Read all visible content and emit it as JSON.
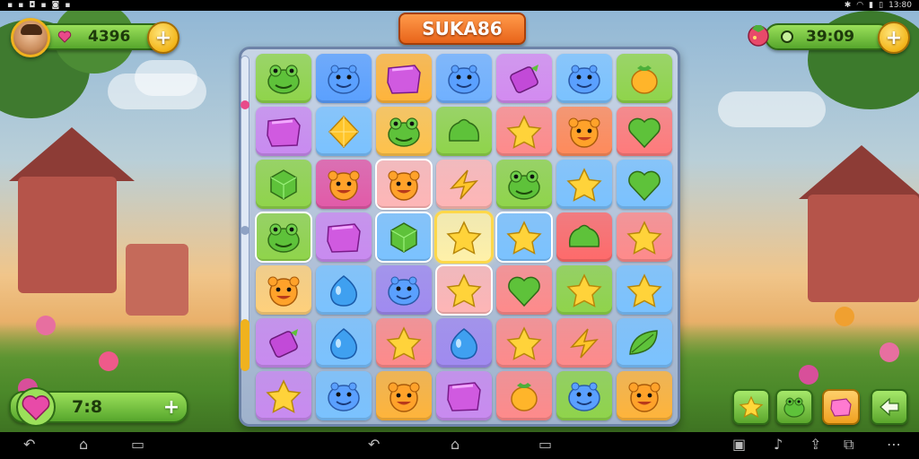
{
  "status_bar": {
    "left_icons": [
      "notification-icon",
      "notification-icon",
      "notification-icon",
      "notification-icon",
      "notification-icon",
      "notification-icon"
    ],
    "right_icons": [
      "bluetooth-icon",
      "wifi-icon",
      "signal-icon",
      "battery-icon"
    ],
    "time": "13:80"
  },
  "hud": {
    "score": "4396",
    "timer": "39:09",
    "lives": "7:8",
    "plus_label": "+"
  },
  "title": "SUKA86",
  "board": {
    "rows": [
      [
        "frog",
        "hippo",
        "cube",
        "hippo",
        "candy",
        "hippo",
        "fruit"
      ],
      [
        "cube",
        "diamond",
        "frog",
        "blob",
        "star",
        "bear",
        "heart"
      ],
      [
        "gem",
        "bear",
        "bear",
        "bolt",
        "frog",
        "star",
        "heart"
      ],
      [
        "frog",
        "cube",
        "gem",
        "star",
        "star",
        "blob",
        "star"
      ],
      [
        "bear",
        "drop",
        "hippo",
        "star",
        "heart",
        "star",
        "star"
      ],
      [
        "candy",
        "drop",
        "star",
        "drop",
        "star",
        "bolt",
        "leaf"
      ],
      [
        "star",
        "hippo",
        "bear",
        "cube",
        "fruit",
        "hippo",
        "bear"
      ]
    ],
    "colors": [
      [
        "#8fd44a",
        "#5aa0ff",
        "#ffb43a",
        "#6fb0ff",
        "#d38af0",
        "#7ac2ff",
        "#8fd44a"
      ],
      [
        "#c98af0",
        "#7ac2ff",
        "#ffc24a",
        "#8fd44a",
        "#ff8a8a",
        "#ff8a5a",
        "#ff7a7a"
      ],
      [
        "#8fd44a",
        "#e25aa8",
        "#ffb6b6",
        "#ffb6b6",
        "#8fd44a",
        "#7ac2ff",
        "#7ac2ff"
      ],
      [
        "#8fd44a",
        "#c98af0",
        "#7ac2ff",
        "#fff1a8",
        "#7ac2ff",
        "#ff6a6a",
        "#ff8a8a"
      ],
      [
        "#ffd07a",
        "#7ac2ff",
        "#a08af0",
        "#ffb6b6",
        "#ff8a8a",
        "#8fd44a",
        "#7ac2ff"
      ],
      [
        "#c98af0",
        "#7ac2ff",
        "#ff8a8a",
        "#a08af0",
        "#ff8a8a",
        "#ff8a8a",
        "#7ac2ff"
      ],
      [
        "#c98af0",
        "#7ac2ff",
        "#ffb43a",
        "#c98af0",
        "#ff8a8a",
        "#8fd44a",
        "#ffb43a"
      ]
    ],
    "selected": [
      3,
      3
    ],
    "highlighted": [
      [
        3,
        0
      ],
      [
        3,
        2
      ],
      [
        3,
        4
      ],
      [
        2,
        2
      ],
      [
        4,
        3
      ]
    ]
  },
  "boosters": [
    "star-booster",
    "frog-booster",
    "cube-booster",
    "arrow-booster"
  ],
  "nav": {
    "items": [
      "back-icon",
      "home-icon",
      "recents-icon",
      "back-icon",
      "home-icon",
      "recents-icon",
      "screenshot-icon",
      "music-icon",
      "share-icon",
      "cast-icon",
      "more-icon"
    ]
  }
}
